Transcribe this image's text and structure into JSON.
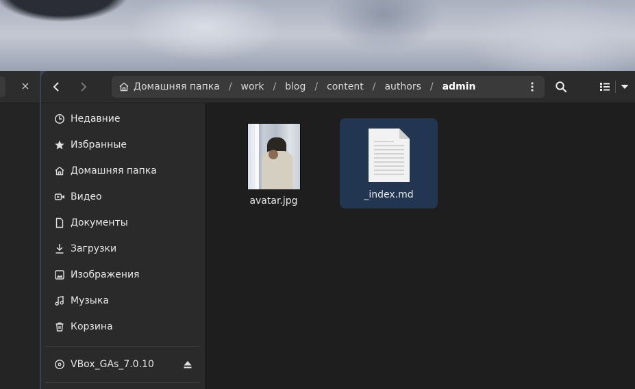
{
  "header": {
    "breadcrumbs": [
      {
        "label": "Домашняя папка",
        "icon": "home-icon"
      },
      {
        "label": "work"
      },
      {
        "label": "blog"
      },
      {
        "label": "content"
      },
      {
        "label": "authors"
      },
      {
        "label": "admin",
        "current": true
      }
    ],
    "separator": "/"
  },
  "back_window": {
    "close_glyph": "×"
  },
  "sidebar": {
    "items": [
      {
        "label": "Недавние",
        "icon": "clock-icon"
      },
      {
        "label": "Избранные",
        "icon": "star-icon"
      },
      {
        "label": "Домашняя папка",
        "icon": "home-icon"
      },
      {
        "label": "Видео",
        "icon": "video-icon"
      },
      {
        "label": "Документы",
        "icon": "document-icon"
      },
      {
        "label": "Загрузки",
        "icon": "download-icon"
      },
      {
        "label": "Изображения",
        "icon": "image-icon"
      },
      {
        "label": "Музыка",
        "icon": "music-icon"
      },
      {
        "label": "Корзина",
        "icon": "trash-icon"
      }
    ],
    "devices": [
      {
        "label": "VBox_GAs_7.0.10",
        "icon": "disc-icon"
      }
    ]
  },
  "files": [
    {
      "name": "avatar.jpg",
      "kind": "image",
      "selected": false
    },
    {
      "name": "_index.md",
      "kind": "text",
      "selected": true
    }
  ],
  "colors": {
    "window_bg": "#1e1e1e",
    "header_bg": "#2b2b2b",
    "sidebar_bg": "#2a2a2a",
    "selection": "#223651",
    "text": "#e6e6e6"
  }
}
